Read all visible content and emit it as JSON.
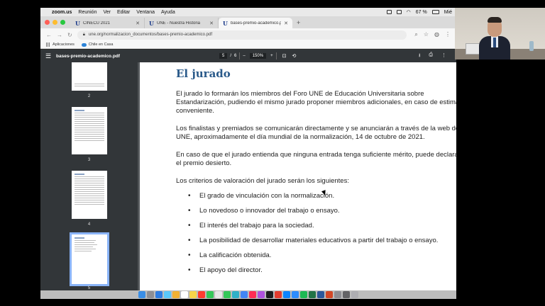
{
  "menubar": {
    "app": "zoom.us",
    "items": [
      "Reunión",
      "Ver",
      "Editar",
      "Ventana",
      "Ayuda"
    ],
    "battery": "67 %",
    "day": "Mié"
  },
  "tabs": [
    {
      "label": "CINECU 2021",
      "favicon": "U"
    },
    {
      "label": "UNE - Nuestra Historia",
      "favicon": "U"
    },
    {
      "label": "bases-premio-academico.pdf",
      "favicon": "U"
    }
  ],
  "address": {
    "url": "une.org/normalizacion_documentos/bases-premio-academico.pdf"
  },
  "bookmarks": [
    {
      "label": "Aplicaciones",
      "icon": "apps-grid-icon"
    },
    {
      "label": "Chile en Casa",
      "icon": "cloud-icon"
    }
  ],
  "pdf_toolbar": {
    "filename": "bases-premio-academico.pdf",
    "current_page": "5",
    "page_sep": "/",
    "total_pages": "6",
    "zoom_minus": "–",
    "zoom": "150%",
    "zoom_plus": "+"
  },
  "thumbnails": [
    {
      "label": "2"
    },
    {
      "label": "3"
    },
    {
      "label": "4"
    },
    {
      "label": "5"
    }
  ],
  "document": {
    "heading": "El jurado",
    "paragraphs": [
      "El jurado lo formarán los miembros del Foro UNE de Educación Universitaria sobre Estandarización, pudiendo el mismo jurado proponer miembros adicionales, en caso de estimarlo conveniente.",
      "Los finalistas y premiados se comunicarán directamente y se anunciarán a través de la web de UNE, aproximadamente el día mundial de la normalización, 14 de octubre de 2021.",
      "En caso de que el jurado entienda que ninguna entrada tenga suficiente mérito, puede declarar el premio desierto.",
      "Los criterios de valoración del jurado serán los siguientes:"
    ],
    "criteria": [
      "El grado de vinculación con la normalización.",
      "Lo novedoso o innovador del trabajo o ensayo.",
      "El interés del trabajo para la sociedad.",
      "La posibilidad de desarrollar materiales educativos a partir del trabajo o ensayo.",
      "La calificación obtenida.",
      "El apoyo del director."
    ]
  },
  "colors": {
    "heading": "#2a5a8a",
    "pdf_toolbar": "#323639",
    "pdf_background": "#525659",
    "selected_thumb": "#8ab4f8"
  }
}
